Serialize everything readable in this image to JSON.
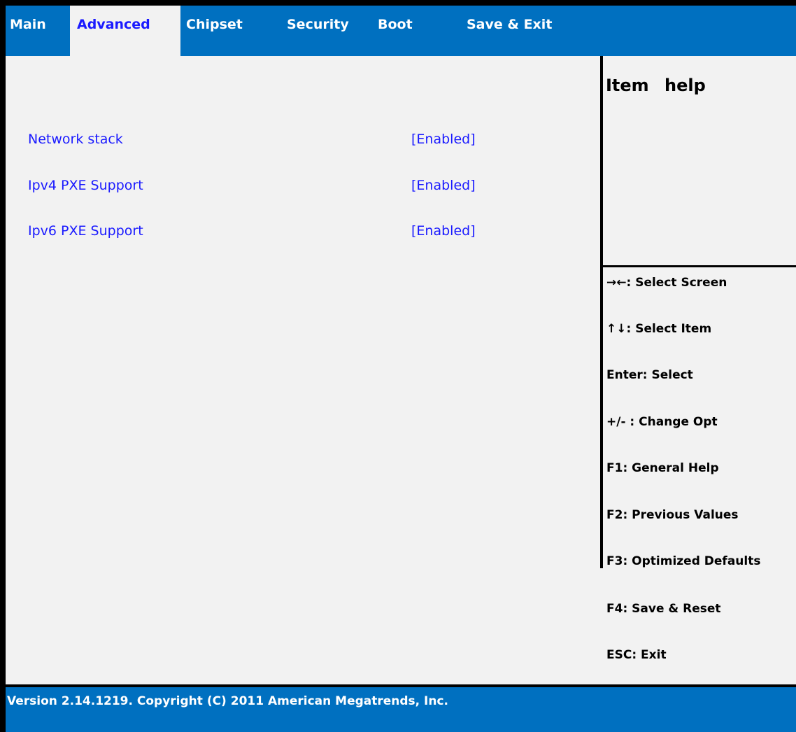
{
  "tabs": [
    {
      "label": "Main"
    },
    {
      "label": "Advanced",
      "active": true
    },
    {
      "label": "Chipset"
    },
    {
      "label": "Security"
    },
    {
      "label": "Boot"
    },
    {
      "label": "Save & Exit"
    }
  ],
  "help_panel": {
    "title": "Item help"
  },
  "settings": [
    {
      "label": "Network stack",
      "value": "[Enabled]"
    },
    {
      "label": "Ipv4 PXE Support",
      "value": "[Enabled]"
    },
    {
      "label": "Ipv6 PXE Support",
      "value": "[Enabled]"
    }
  ],
  "key_hints": [
    "→←: Select Screen",
    "↑↓: Select Item",
    "Enter: Select",
    "+/- : Change Opt",
    "F1: General Help",
    "F2: Previous Values",
    "F3: Optimized Defaults",
    "F4: Save & Reset",
    "ESC: Exit"
  ],
  "footer": {
    "version": "Version 2.14.1219. Copyright (C) 2011 American Megatrends, Inc."
  },
  "colors": {
    "bar_blue": "#0070c0",
    "setting_blue": "#1a1aff",
    "panel_bg": "#f2f2f2"
  }
}
